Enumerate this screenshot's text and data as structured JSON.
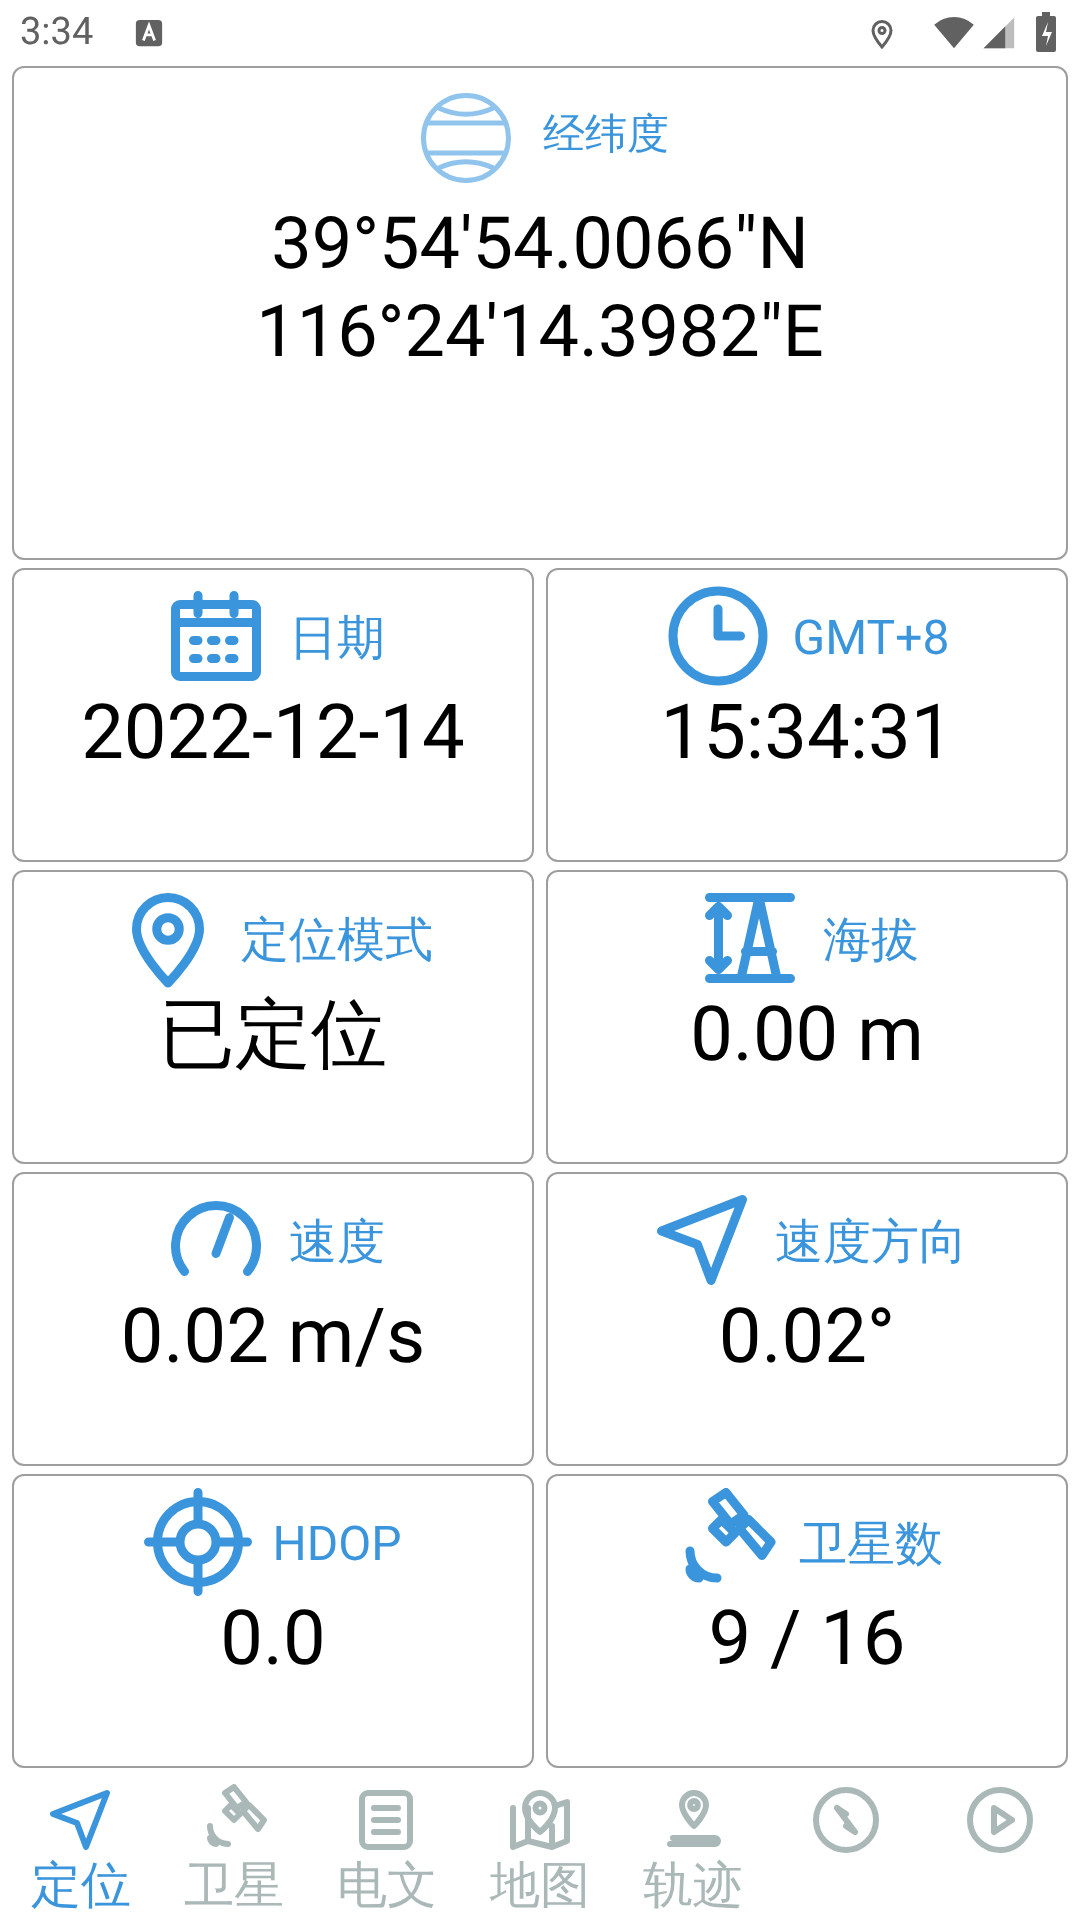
{
  "status_bar": {
    "time": "3:34"
  },
  "coordinates": {
    "label": "经纬度",
    "latitude": "39°54'54.0066\"N",
    "longitude": "116°24'14.3982\"E"
  },
  "cards": [
    {
      "kind": "calendar",
      "label": "日期",
      "value": "2022-12-14"
    },
    {
      "kind": "clock",
      "label": "GMT+8",
      "value": "15:34:31"
    },
    {
      "kind": "pin",
      "label": "定位模式",
      "value": "已定位"
    },
    {
      "kind": "altitude",
      "label": "海拔",
      "value": "0.00 m"
    },
    {
      "kind": "gauge",
      "label": "速度",
      "value": "0.02 m/s"
    },
    {
      "kind": "arrow",
      "label": "速度方向",
      "value": "0.02°"
    },
    {
      "kind": "target",
      "label": "HDOP",
      "value": "0.0"
    },
    {
      "kind": "satellite",
      "label": "卫星数",
      "value": "9 / 16"
    }
  ],
  "nav": [
    {
      "kind": "arrow",
      "label": "定位",
      "selected": true
    },
    {
      "kind": "satellite",
      "label": "卫星",
      "selected": false
    },
    {
      "kind": "document",
      "label": "电文",
      "selected": false
    },
    {
      "kind": "map",
      "label": "地图",
      "selected": false
    },
    {
      "kind": "track",
      "label": "轨迹",
      "selected": false
    },
    {
      "kind": "compass",
      "selected": false
    },
    {
      "kind": "play",
      "selected": false
    }
  ]
}
